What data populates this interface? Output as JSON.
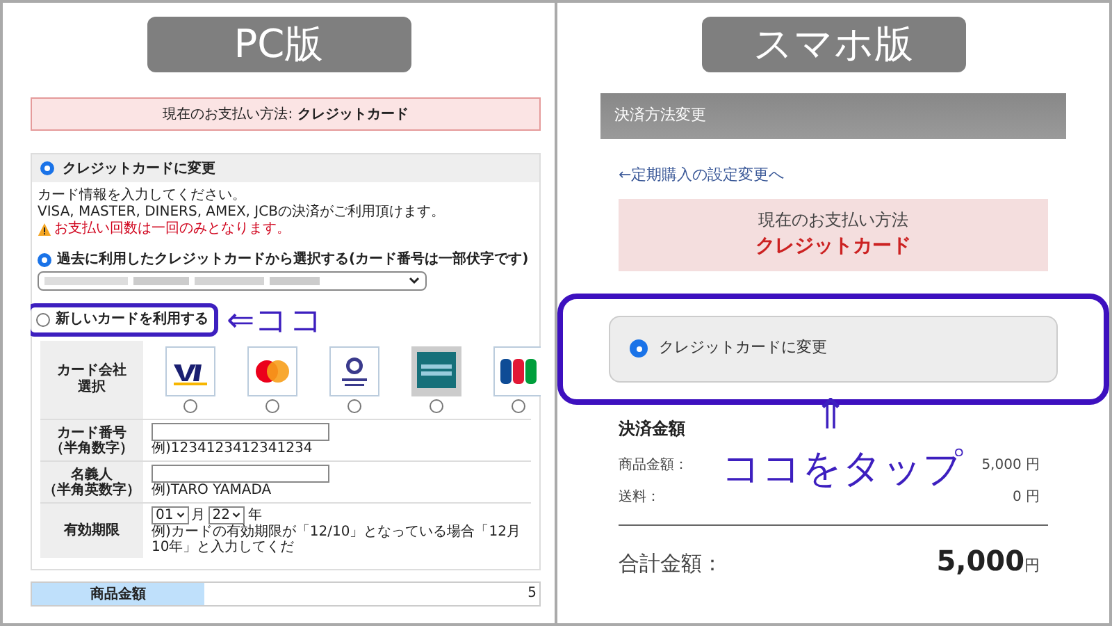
{
  "pc": {
    "label": "PC版",
    "current_payment": "現在のお支払い方法: **クレジットカード**",
    "change_option": {
      "label": "クレジットカードに変更",
      "selected": true
    },
    "notes": [
      "カード情報を入力してください。",
      "VISA, MASTER, DINERS, AMEX, JCBの決済がご利用頂けます。"
    ],
    "warning": "お支払い回数は一回のみとなります。",
    "card_choices": [
      {
        "kind": "saved",
        "label": "過去に利用したクレジットカードから選択する(カード番号は一部伏字です)",
        "selected": true
      },
      {
        "kind": "new",
        "label": "新しいカードを利用する",
        "selected": false
      }
    ],
    "brand_label": [
      "カード会社",
      "選択"
    ],
    "brands": [
      {
        "kind": "visa",
        "selected": false
      },
      {
        "kind": "mastercard",
        "selected": false
      },
      {
        "kind": "diners",
        "selected": false
      },
      {
        "kind": "amex",
        "selected": false
      },
      {
        "kind": "jcb",
        "selected": false
      }
    ],
    "fields": [
      {
        "label": [
          "カード番号",
          "（半角数字）"
        ],
        "hint": "例)1234123412341234"
      },
      {
        "label": [
          "名義人",
          "（半角英数字）"
        ],
        "hint": "例)TARO YAMADA"
      }
    ],
    "expiry": {
      "label": "有効期限",
      "month": "01",
      "month_unit": "月",
      "year": "22",
      "year_unit": "年",
      "hint": "例)カードの有効期限が「12/10」となっている場合「12月10年」と入力してくだ"
    },
    "summary": {
      "label": "商品金額",
      "value": "5"
    },
    "annotation": "⇐ココ"
  },
  "sp": {
    "label": "スマホ版",
    "title": "決済方法変更",
    "back_link": "←定期購入の設定変更へ",
    "current_payment": {
      "heading": "現在のお支払い方法",
      "value": "クレジットカード"
    },
    "change_option": {
      "label": "クレジットカードに変更",
      "selected": true
    },
    "amount": {
      "heading": "決済金額",
      "rows": [
        {
          "label": "商品金額：",
          "value": "5,000 円"
        },
        {
          "label": "送料：",
          "value": "0 円"
        }
      ],
      "total": {
        "label": "合計金額：",
        "amount": "5,000",
        "unit": "円"
      }
    },
    "annotation": {
      "arrow": "⇑",
      "text": "ココをタップ"
    }
  }
}
